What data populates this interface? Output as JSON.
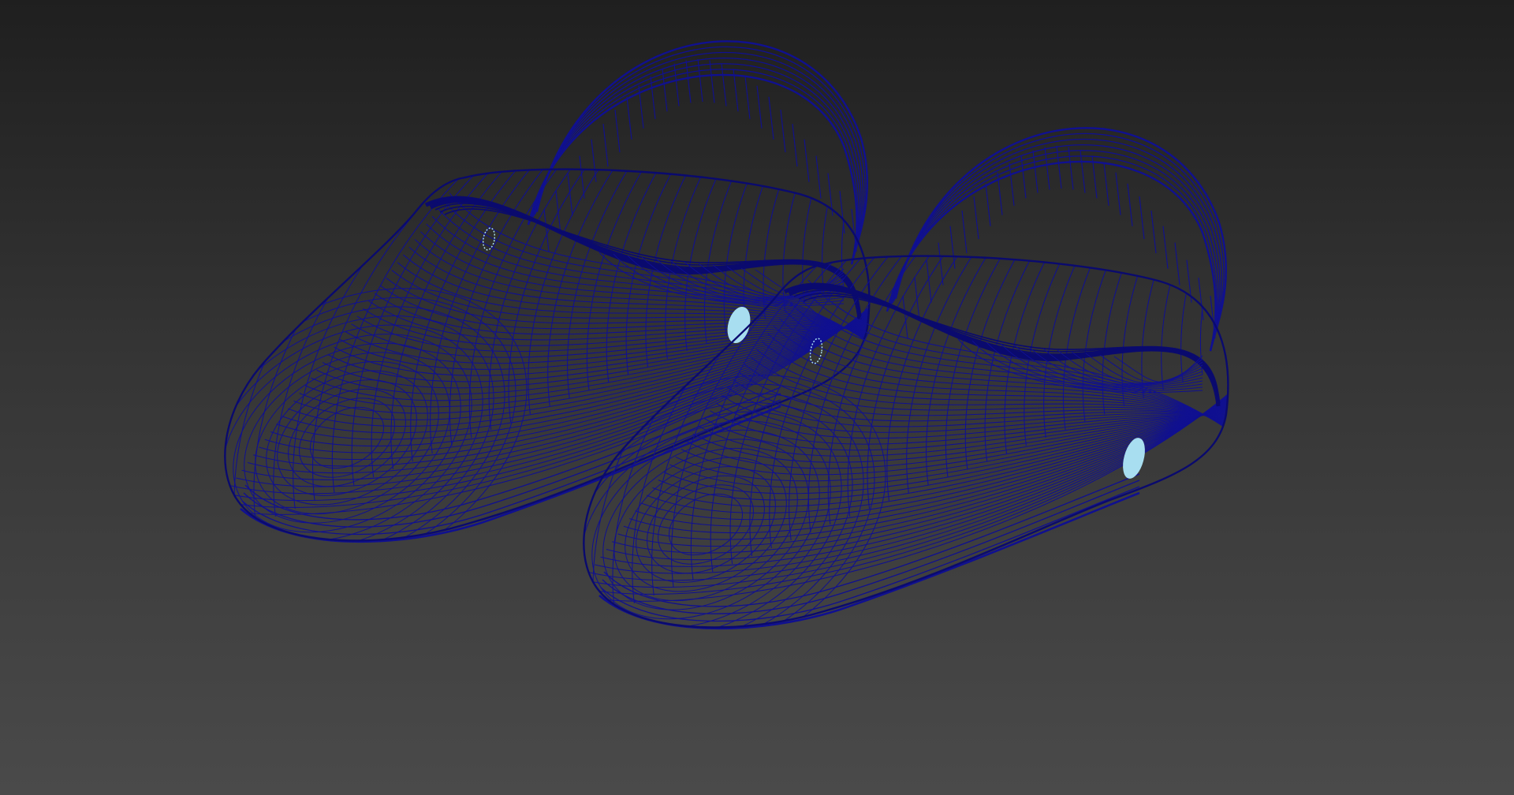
{
  "viewport": {
    "background_top_color": "#1f1f1f",
    "background_bottom_color": "#4a4a4a",
    "render_mode": "wireframe"
  },
  "model": {
    "wire_color": "#101090",
    "wire_color_dark": "#0a0a6e",
    "accent_color": "#a8def0",
    "objects": [
      {
        "name": "left-clog",
        "features": [
          "upper",
          "sole",
          "heel-strap",
          "rivet-outer",
          "rivet-inner"
        ]
      },
      {
        "name": "right-clog",
        "features": [
          "upper",
          "sole",
          "heel-strap",
          "rivet-outer",
          "rivet-inner"
        ]
      }
    ]
  }
}
